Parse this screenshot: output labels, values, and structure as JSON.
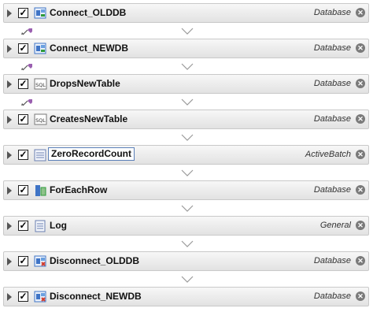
{
  "steps": [
    {
      "name": "Connect_OLDDB",
      "category": "Database",
      "icon": "database-connect-icon",
      "checked": true
    },
    {
      "name": "Connect_NEWDB",
      "category": "Database",
      "icon": "database-connect-icon",
      "checked": true
    },
    {
      "name": "DropsNewTable",
      "category": "Database",
      "icon": "sql-icon",
      "checked": true
    },
    {
      "name": "CreatesNewTable",
      "category": "Database",
      "icon": "sql-icon",
      "checked": true
    },
    {
      "name": "ZeroRecordCount",
      "category": "ActiveBatch",
      "icon": "variable-icon",
      "checked": true,
      "editing": true
    },
    {
      "name": "ForEachRow",
      "category": "Database",
      "icon": "for-each-icon",
      "checked": true
    },
    {
      "name": "Log",
      "category": "General",
      "icon": "log-icon",
      "checked": true
    },
    {
      "name": "Disconnect_OLDDB",
      "category": "Database",
      "icon": "database-disconnect-icon",
      "checked": true
    },
    {
      "name": "Disconnect_NEWDB",
      "category": "Database",
      "icon": "database-disconnect-icon",
      "checked": true
    }
  ],
  "links_after": [
    0,
    1,
    2
  ],
  "colors": {
    "accent": "#5a7fb8",
    "icon_blue": "#3f74c6",
    "icon_green": "#2e9b3a",
    "link_purple": "#9a5fb0",
    "disconnect_red": "#d23b2b"
  }
}
